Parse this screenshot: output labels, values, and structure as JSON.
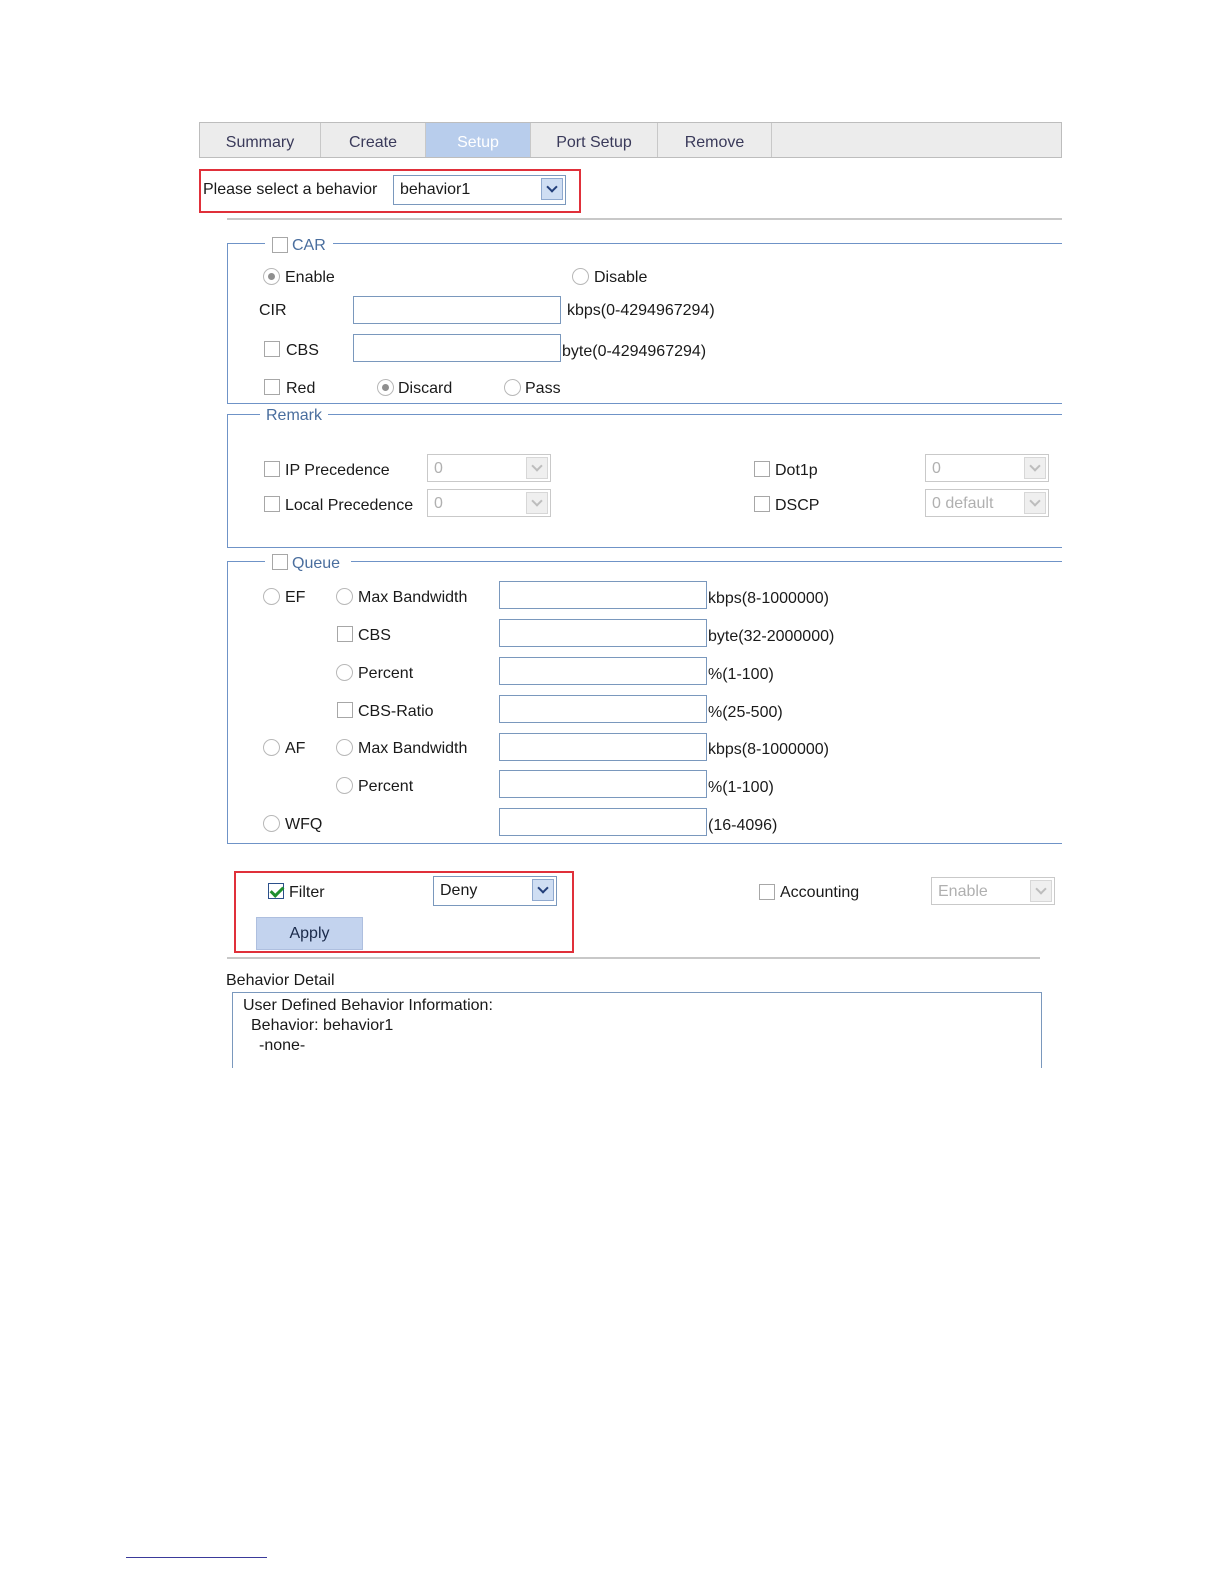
{
  "tabs": [
    "Summary",
    "Create",
    "Setup",
    "Port Setup",
    "Remove"
  ],
  "behavior_select": {
    "label": "Please select a behavior",
    "value": "behavior1"
  },
  "car": {
    "legend": "CAR",
    "enable_label": "Enable",
    "disable_label": "Disable",
    "cir_label": "CIR",
    "cir_unit": "kbps(0-4294967294)",
    "cbs_label": "CBS",
    "cbs_unit": "byte(0-4294967294)",
    "red_label": "Red",
    "discard_label": "Discard",
    "pass_label": "Pass"
  },
  "remark": {
    "legend": "Remark",
    "ip_precedence_label": "IP Precedence",
    "ip_precedence_value": "0",
    "local_precedence_label": "Local Precedence",
    "local_precedence_value": "0",
    "dot1p_label": "Dot1p",
    "dot1p_value": "0",
    "dscp_label": "DSCP",
    "dscp_value": "0 default"
  },
  "queue": {
    "legend": "Queue",
    "ef_label": "EF",
    "af_label": "AF",
    "wfq_label": "WFQ",
    "max_bandwidth_label": "Max Bandwidth",
    "cbs_label": "CBS",
    "percent_label": "Percent",
    "cbs_ratio_label": "CBS-Ratio",
    "ef_max_bw_unit": "kbps(8-1000000)",
    "ef_cbs_unit": "byte(32-2000000)",
    "ef_percent_unit": "%(1-100)",
    "ef_cbs_ratio_unit": "%(25-500)",
    "af_max_bw_unit": "kbps(8-1000000)",
    "af_percent_unit": "%(1-100)",
    "wfq_unit": "(16-4096)"
  },
  "filter": {
    "label": "Filter",
    "value": "Deny",
    "checked": true
  },
  "accounting": {
    "label": "Accounting",
    "value": "Enable"
  },
  "apply_label": "Apply",
  "detail": {
    "title": "Behavior Detail",
    "line1": "User Defined Behavior Information:",
    "line2": "Behavior: behavior1",
    "line3": "-none-"
  }
}
